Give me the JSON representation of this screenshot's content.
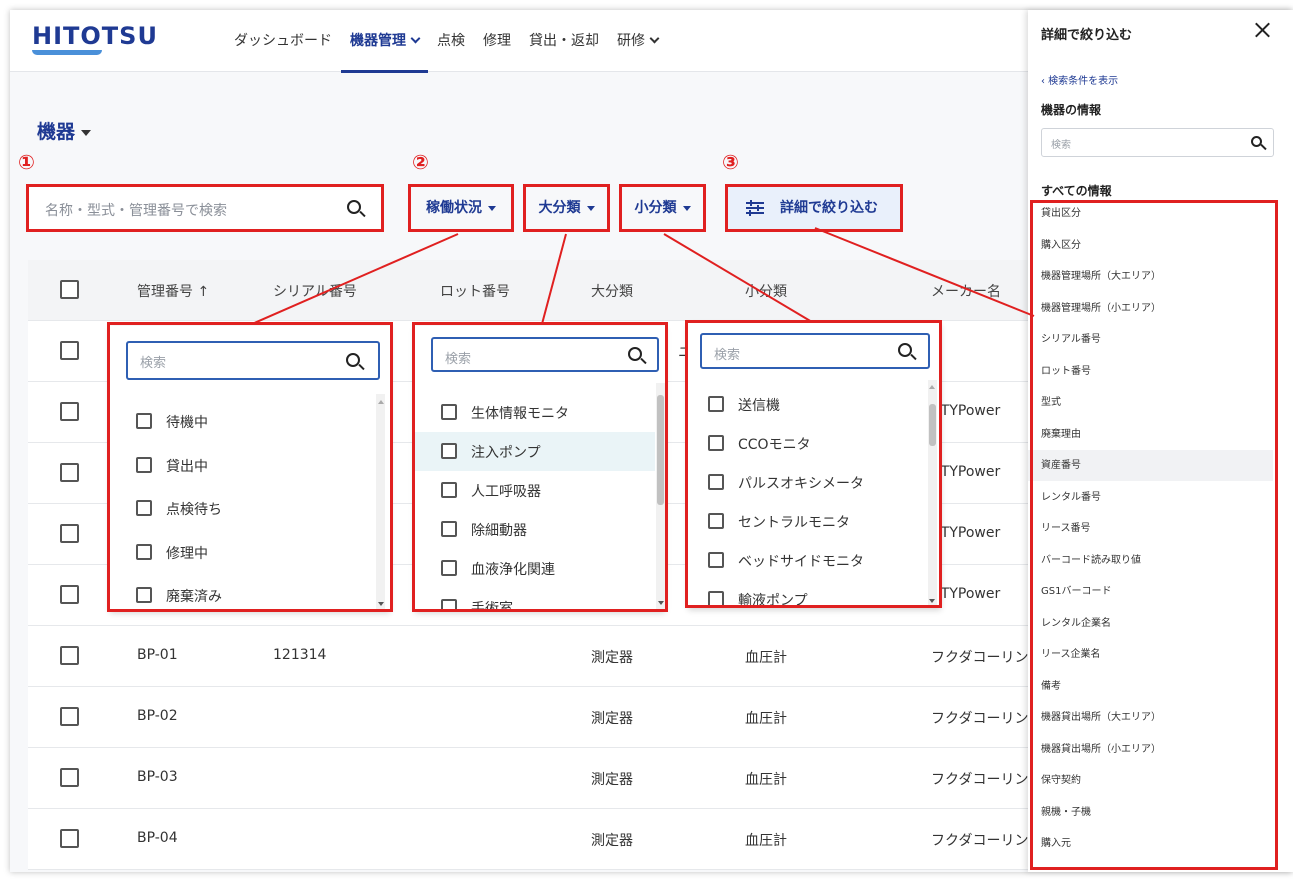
{
  "header": {
    "logo": "HITOTSU",
    "nav": [
      {
        "label": "ダッシュボード",
        "chevron": false,
        "active": false
      },
      {
        "label": "機器管理",
        "chevron": true,
        "active": true
      },
      {
        "label": "点検",
        "chevron": false,
        "active": false
      },
      {
        "label": "修理",
        "chevron": false,
        "active": false
      },
      {
        "label": "貸出・返却",
        "chevron": false,
        "active": false
      },
      {
        "label": "研修",
        "chevron": true,
        "active": false
      }
    ]
  },
  "page": {
    "title": "機器"
  },
  "markers": [
    "①",
    "②",
    "③"
  ],
  "search": {
    "placeholder": "名称・型式・管理番号で検索"
  },
  "filters": {
    "status_label": "稼働状況",
    "major_label": "大分類",
    "minor_label": "小分類",
    "detail_label": "詳細で絞り込む"
  },
  "table": {
    "columns": [
      "管理番号 ↑",
      "シリアル番号",
      "ロット番号",
      "大分類",
      "小分類",
      "メーカー名"
    ],
    "partial_rows": [
      {
        "maker": "CTYPower"
      },
      {
        "maker": "CTYPower"
      },
      {
        "maker": "CTYPower"
      },
      {
        "maker": "CTYPower"
      }
    ],
    "partial_glyph": "ニ",
    "rows": [
      {
        "id": "BP-01",
        "serial": "121314",
        "lot": "",
        "major": "測定器",
        "minor": "血圧計",
        "maker": "フクダコーリン"
      },
      {
        "id": "BP-02",
        "serial": "",
        "lot": "",
        "major": "測定器",
        "minor": "血圧計",
        "maker": "フクダコーリン"
      },
      {
        "id": "BP-03",
        "serial": "",
        "lot": "",
        "major": "測定器",
        "minor": "血圧計",
        "maker": "フクダコーリン"
      },
      {
        "id": "BP-04",
        "serial": "",
        "lot": "",
        "major": "測定器",
        "minor": "血圧計",
        "maker": "フクダコーリン"
      }
    ]
  },
  "dropdowns": {
    "status": {
      "placeholder": "検索",
      "options": [
        "待機中",
        "貸出中",
        "点検待ち",
        "修理中",
        "廃棄済み"
      ]
    },
    "major": {
      "placeholder": "検索",
      "options": [
        "生体情報モニタ",
        "注入ポンプ",
        "人工呼吸器",
        "除細動器",
        "血液浄化関連",
        "手術室"
      ],
      "highlighted": 1
    },
    "minor": {
      "placeholder": "検索",
      "options": [
        "送信機",
        "CCOモニタ",
        "パルスオキシメータ",
        "セントラルモニタ",
        "ベッドサイドモニタ",
        "輸液ポンプ"
      ]
    }
  },
  "panel": {
    "title": "詳細で絞り込む",
    "show_conditions": "‹ 検索条件を表示",
    "device_info_heading": "機器の情報",
    "search_placeholder": "検索",
    "all_info_heading": "すべての情報",
    "items": [
      "貸出区分",
      "購入区分",
      "機器管理場所（大エリア）",
      "機器管理場所（小エリア）",
      "シリアル番号",
      "ロット番号",
      "型式",
      "廃棄理由",
      "資産番号",
      "レンタル番号",
      "リース番号",
      "バーコード読み取り値",
      "GS1バーコード",
      "レンタル企業名",
      "リース企業名",
      "備考",
      "機器貸出場所（大エリア）",
      "機器貸出場所（小エリア）",
      "保守契約",
      "親機・子機",
      "購入元"
    ],
    "highlighted_item": 8
  },
  "colors": {
    "brand": "#1f3a93",
    "annotation": "#e02020",
    "accent": "#4a90d9"
  }
}
